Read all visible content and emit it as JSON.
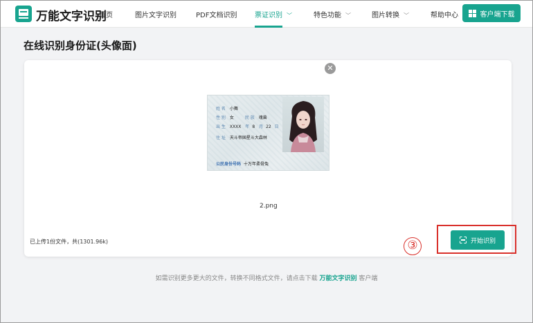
{
  "colors": {
    "accent": "#18a48f",
    "annotation": "#d9302b"
  },
  "header": {
    "logo_text": "万能文字识别",
    "nav": [
      {
        "label": "首页"
      },
      {
        "label": "图片文字识别"
      },
      {
        "label": "PDF文档识别"
      },
      {
        "label": "票证识别",
        "active": true
      },
      {
        "label": "特色功能"
      },
      {
        "label": "图片转换"
      },
      {
        "label": "帮助中心"
      }
    ],
    "download_label": "客户端下载"
  },
  "page_title": "在线识别身份证(头像面)",
  "upload": {
    "filename": "2.png",
    "info": "已上传1份文件，共(1301.96k)",
    "start_label": "开始识别"
  },
  "idcard": {
    "name_label": "姓 名",
    "name": "小舞",
    "gender_label": "性 别",
    "gender": "女",
    "ethnic_label": "民 族",
    "ethnic": "魂兽",
    "birth_label": "出 生",
    "birth_year": "XXXX",
    "year_label": "年",
    "birth_month": "8",
    "month_label": "月",
    "birth_day": "22",
    "day_label": "日",
    "address_label": "住 址",
    "address": "天斗帝国星斗大森林",
    "id_label": "公民身份号码",
    "id_number": "十万年柔骨兔"
  },
  "annotation": {
    "step": "③"
  },
  "footer": {
    "before": "如需识别更多更大的文件，转换不同格式文件，请点击下载",
    "brand": "万能文字识别",
    "after": "客户端"
  }
}
